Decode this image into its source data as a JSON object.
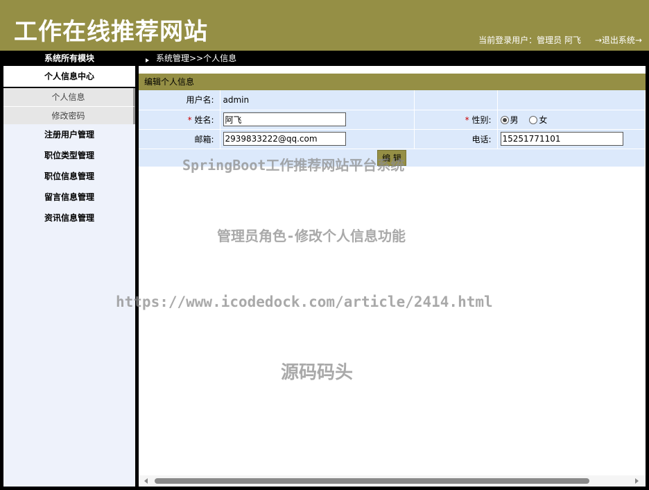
{
  "header": {
    "site_title": "工作在线推荐网站",
    "user_text": "当前登录用户：管理员 阿飞",
    "logout_label": "→退出系统→"
  },
  "sidebar": {
    "title": "系统所有模块",
    "active_group": "个人信息中心",
    "submenu": [
      "个人信息",
      "修改密码"
    ],
    "items": [
      "注册用户管理",
      "职位类型管理",
      "职位信息管理",
      "留言信息管理",
      "资讯信息管理"
    ]
  },
  "breadcrumb": "系统管理>>个人信息",
  "panel": {
    "title": "编辑个人信息",
    "username_label": "用户名:",
    "username_value": "admin",
    "name_label": "姓名:",
    "name_value": "阿飞",
    "gender_label": "性别:",
    "gender_male": "男",
    "gender_female": "女",
    "gender_selected": "男",
    "email_label": "邮箱:",
    "email_value": "2939833222@qq.com",
    "phone_label": "电话:",
    "phone_value": "15251771101",
    "edit_button": "编 辑",
    "required_mark": "*"
  },
  "watermarks": {
    "line1": "SpringBoot工作推荐网站平台系统",
    "line2": "管理员角色-修改个人信息功能",
    "line3": "https://www.icodedock.com/article/2414.html",
    "line4": "源码码头"
  },
  "colors": {
    "accent": "#958f45",
    "form_bg": "#dce9fb",
    "sidebar_bg": "#eef2fb"
  }
}
